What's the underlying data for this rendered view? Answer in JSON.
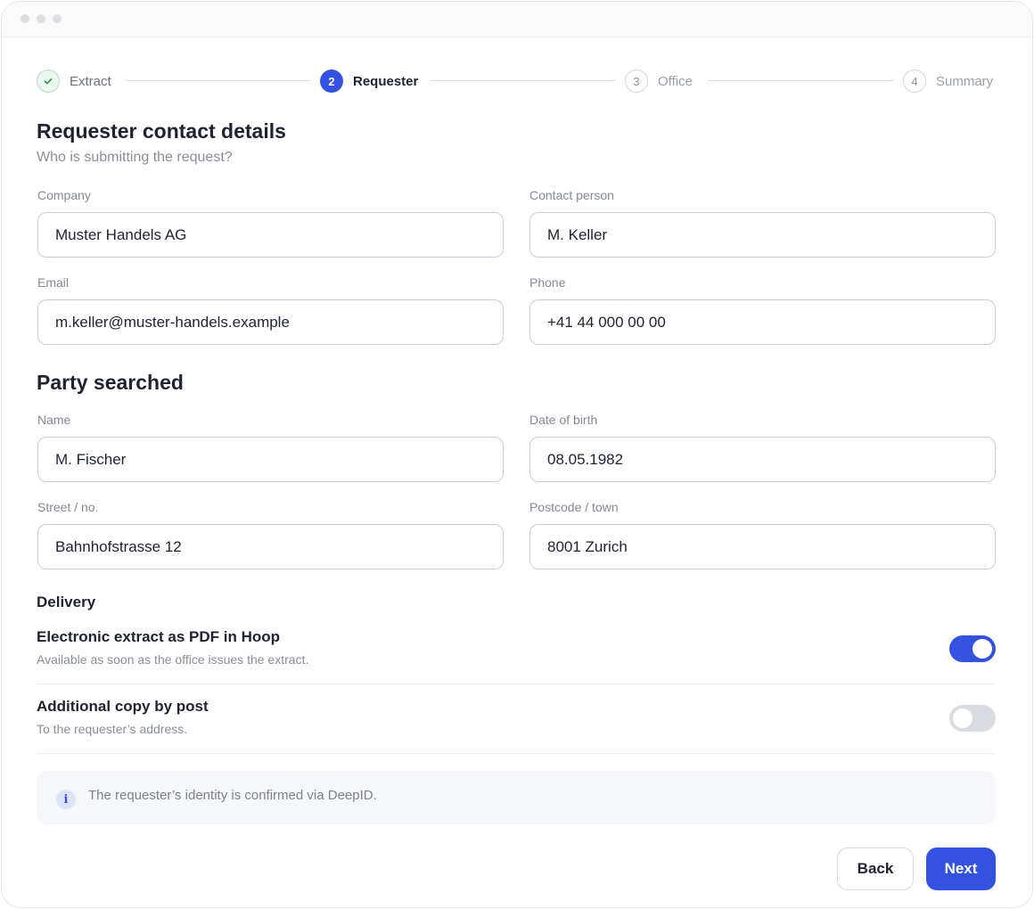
{
  "stepper": {
    "steps": [
      {
        "number": "",
        "label": "Extract",
        "state": "done"
      },
      {
        "number": "2",
        "label": "Requester",
        "state": "active"
      },
      {
        "number": "3",
        "label": "Office",
        "state": "todo"
      },
      {
        "number": "4",
        "label": "Summary",
        "state": "todo"
      }
    ]
  },
  "requester": {
    "title": "Requester contact details",
    "subtitle": "Who is submitting the request?",
    "fields": {
      "company": {
        "label": "Company",
        "value": "Muster Handels AG"
      },
      "contact_person": {
        "label": "Contact person",
        "value": "M. Keller"
      },
      "email": {
        "label": "Email",
        "value": "m.keller@muster-handels.example"
      },
      "phone": {
        "label": "Phone",
        "value": "+41 44 000 00 00"
      }
    }
  },
  "party": {
    "title": "Party searched",
    "fields": {
      "name": {
        "label": "Name",
        "value": "M. Fischer"
      },
      "date_of_birth": {
        "label": "Date of birth",
        "value": "08.05.1982"
      },
      "street": {
        "label": "Street / no.",
        "value": "Bahnhofstrasse 12"
      },
      "postcode_town": {
        "label": "Postcode / town",
        "value": "8001 Zurich"
      }
    }
  },
  "delivery": {
    "title": "Delivery",
    "options": [
      {
        "title": "Electronic extract as PDF in Hoop",
        "description": "Available as soon as the office issues the extract.",
        "enabled": true
      },
      {
        "title": "Additional copy by post",
        "description": "To the requester’s address.",
        "enabled": false
      }
    ]
  },
  "info": {
    "icon": "info-icon",
    "text": "The requester’s identity is confirmed via DeepID."
  },
  "actions": {
    "back_label": "Back",
    "next_label": "Next"
  },
  "colors": {
    "accent": "#3352e0",
    "done_green": "#2f8a4c"
  }
}
